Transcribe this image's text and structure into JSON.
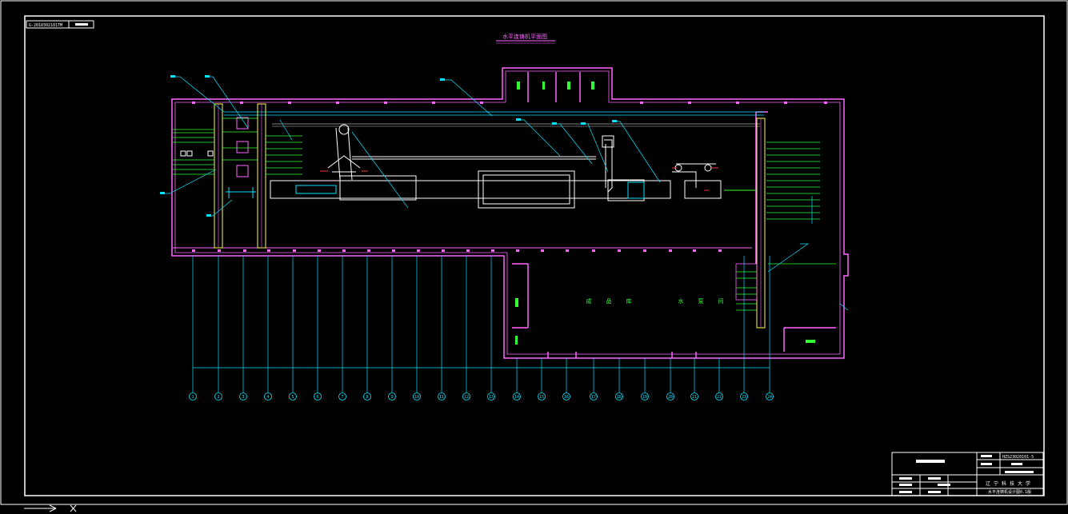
{
  "drawing": {
    "code_label": "G-2010302101TM",
    "title": "水平连铸机平面图",
    "room_left": "成品库",
    "room_right": "水泵间",
    "colors": {
      "background": "#000000",
      "frame": "#ffffff",
      "wall": "#ff66ff",
      "leader": "#00e5ff",
      "green": "#33ff33",
      "yellow": "#ffff44",
      "red": "#ff3333"
    }
  },
  "title_block": {
    "drawing_no": "HZS23020101-5",
    "university": "辽宁科技大学",
    "project_name": "水平连铸机设计图0.1版"
  },
  "axis_labels": [
    "1",
    "2",
    "3",
    "4",
    "5",
    "6",
    "7",
    "8",
    "9",
    "10",
    "11",
    "12",
    "13",
    "14",
    "15",
    "16",
    "17",
    "18",
    "19",
    "20",
    "21",
    "22",
    "23",
    "24"
  ]
}
